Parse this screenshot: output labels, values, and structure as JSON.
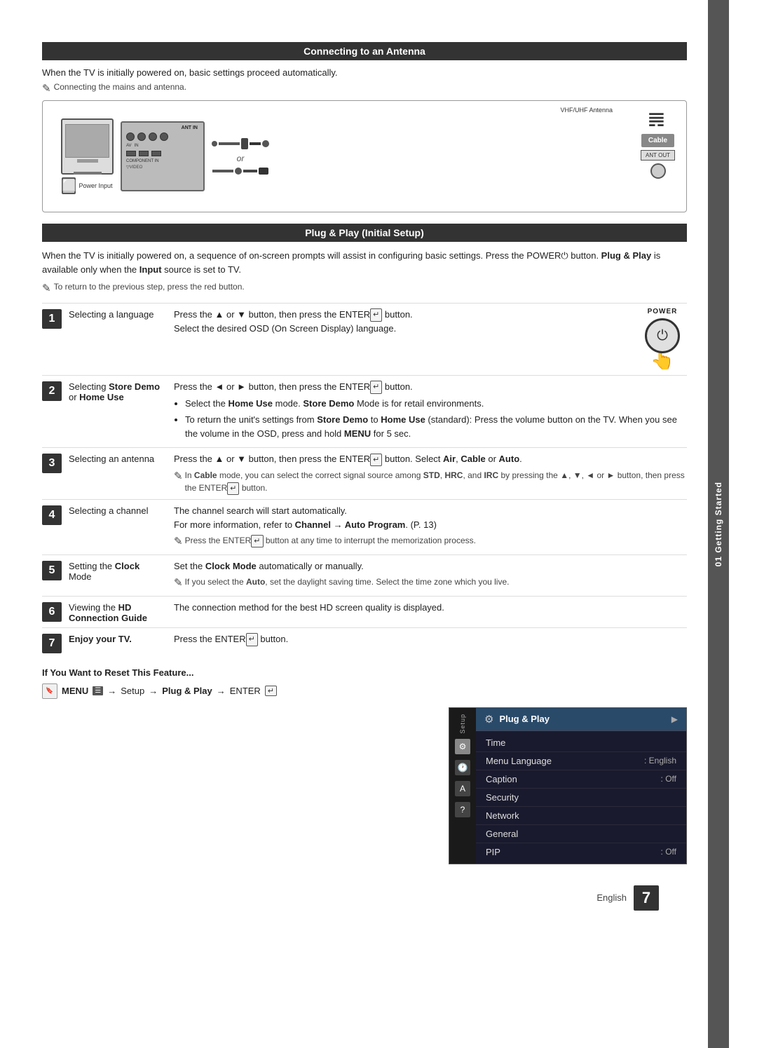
{
  "page": {
    "number": "7",
    "language": "English"
  },
  "sidetab": {
    "label": "01 Getting Started"
  },
  "section1": {
    "header": "Connecting to an Antenna",
    "intro": "When the TV is initially powered on, basic settings proceed automatically.",
    "note": "Connecting the mains and antenna.",
    "vhf_label": "VHF/UHF Antenna",
    "cable_label": "Cable",
    "ant_out_label": "ANT OUT",
    "ant_in_label": "ANT IN",
    "power_input_label": "Power Input",
    "or_label": "or"
  },
  "section2": {
    "header": "Plug & Play (Initial Setup)",
    "intro1": "When the TV is initially powered on, a sequence of on-screen prompts will assist in configuring basic settings. Press the POWER",
    "intro2": " button. ",
    "intro3": "Plug & Play",
    "intro4": " is available only when the ",
    "intro5": "Input",
    "intro6": " source is set to TV.",
    "note": "To return to the previous step, press the red button.",
    "power_label": "POWER"
  },
  "steps": [
    {
      "number": "1",
      "label": "Selecting a language",
      "desc_main": "Press the ▲ or ▼ button, then press the ENTER",
      "desc_after": " button.",
      "desc_sub": "Select the desired OSD (On Screen Display) language."
    },
    {
      "number": "2",
      "label_part1": "Selecting ",
      "label_bold": "Store Demo",
      "label_part2": "\nor ",
      "label_bold2": "Home Use",
      "desc_main": "Press the ◄ or ► button, then press the ENTER",
      "desc_after": " button.",
      "bullet1": "Select the ",
      "bullet1_bold": "Home Use",
      "bullet1_cont": " mode. ",
      "bullet1_bold2": "Store Demo",
      "bullet1_cont2": " Mode is for retail environments.",
      "bullet2_pre": "To return the unit's settings from ",
      "bullet2_bold1": "Store Demo",
      "bullet2_mid": " to ",
      "bullet2_bold2": "Home Use",
      "bullet2_cont": " (standard): Press the volume button on the TV. When you see the volume in the OSD, press and hold ",
      "bullet2_bold3": "MENU",
      "bullet2_end": " for 5 sec."
    },
    {
      "number": "3",
      "label": "Selecting an antenna",
      "desc_main": "Press the ▲ or ▼ button, then press the ENTER",
      "desc_after": " button. Select ",
      "desc_bold1": "Air",
      "desc_sep1": ", ",
      "desc_bold2": "Cable",
      "desc_sep2": " or ",
      "desc_bold3": "Auto",
      "desc_end": ".",
      "sub_note": "In ",
      "sub_note_bold": "Cable",
      "sub_note_cont": " mode, you can select the correct signal source among ",
      "sub_note_bold2": "STD",
      "sub_note_sep": ", ",
      "sub_note_bold3": "HRC",
      "sub_note_sep2": ", and ",
      "sub_note_bold4": "IRC",
      "sub_note_end1": " by pressing the ▲, ▼, ◄ or ► button, then press the ENTER",
      "sub_note_end2": " button."
    },
    {
      "number": "4",
      "label": "Selecting a channel",
      "desc_main": "The channel search will start automatically.",
      "desc_sub": "For more information, refer to ",
      "desc_bold": "Channel → Auto Program",
      "desc_cont": ". (P. 13)",
      "sub_note": "Press the ENTER",
      "sub_note_end": " button at any time to interrupt the memorization process."
    },
    {
      "number": "5",
      "label_pre": "Setting the ",
      "label_bold": "Clock",
      "label_post": " Mode",
      "desc_main": "Set the ",
      "desc_bold": "Clock Mode",
      "desc_cont": " automatically or manually.",
      "sub_note": "If you select the ",
      "sub_note_bold": "Auto",
      "sub_note_cont": ", set the daylight saving time. Select the time zone which you live."
    },
    {
      "number": "6",
      "label_pre": "Viewing the ",
      "label_bold": "HD Connection Guide",
      "desc_main": "The connection method for the best HD screen quality is displayed."
    },
    {
      "number": "7",
      "label_bold": "Enjoy your TV.",
      "desc_main": "Press the ENTER",
      "desc_end": " button."
    }
  ],
  "reset_section": {
    "title": "If You Want to Reset This Feature...",
    "instruction": "MENU",
    "arrow1": "→",
    "step1": "Setup",
    "arrow2": "→",
    "step2": "Plug & Play",
    "arrow3": "→",
    "step3": "ENTER"
  },
  "setup_menu": {
    "sidebar_label": "Setup",
    "header_title": "Plug & Play",
    "rows": [
      {
        "label": "Time",
        "value": ""
      },
      {
        "label": "Menu Language",
        "value": ": English"
      },
      {
        "label": "Caption",
        "value": ": Off"
      },
      {
        "label": "Security",
        "value": ""
      },
      {
        "label": "Network",
        "value": ""
      },
      {
        "label": "General",
        "value": ""
      },
      {
        "label": "PIP",
        "value": ": Off"
      }
    ]
  }
}
